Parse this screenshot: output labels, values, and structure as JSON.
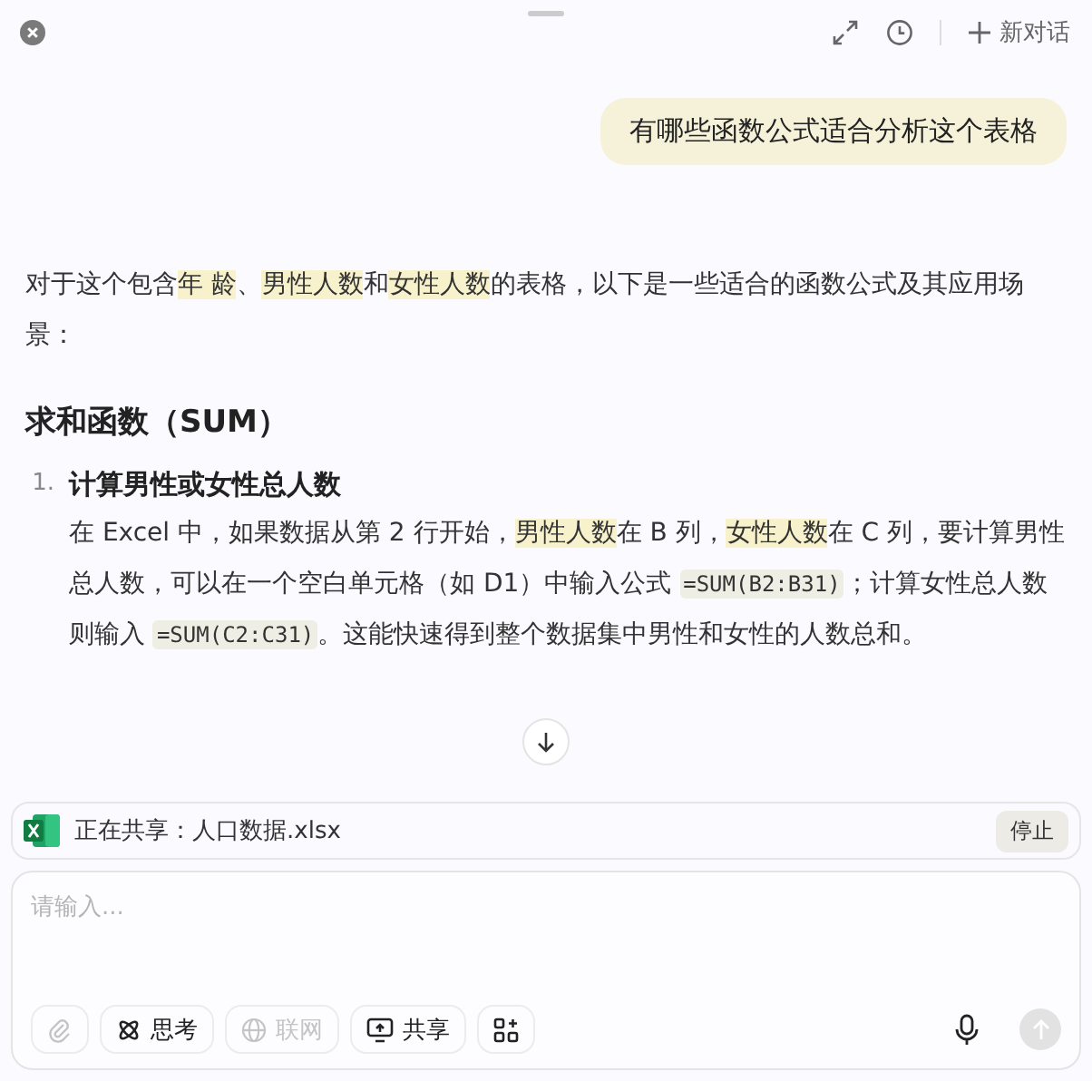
{
  "header": {
    "new_chat_label": "新对话"
  },
  "user_message": "有哪些函数公式适合分析这个表格",
  "intro": [
    {
      "kind": "plain",
      "text": "对于这个包含"
    },
    {
      "kind": "highlight",
      "text": "年  龄"
    },
    {
      "kind": "plain",
      "text": "、"
    },
    {
      "kind": "highlight",
      "text": "男性人数"
    },
    {
      "kind": "plain",
      "text": "和"
    },
    {
      "kind": "highlight",
      "text": "女性人数"
    },
    {
      "kind": "plain",
      "text": "的表格，以下是一些适合的函数公式及其应用场景："
    }
  ],
  "section_heading": "求和函数（SUM）",
  "list_items": [
    {
      "number": "1.",
      "title": "计算男性或女性总人数",
      "body": [
        {
          "kind": "plain",
          "text": "在 Excel 中，如果数据从第 2 行开始，"
        },
        {
          "kind": "highlight",
          "text": "男性人数"
        },
        {
          "kind": "plain",
          "text": "在 B 列，"
        },
        {
          "kind": "highlight",
          "text": "女性人数"
        },
        {
          "kind": "plain",
          "text": "在 C 列，要计算男性总人数，可以在一个空白单元格（如 D1）中输入公式 "
        },
        {
          "kind": "code",
          "text": "=SUM(B2:B31)"
        },
        {
          "kind": "plain",
          "text": "；计算女性总人数则输入 "
        },
        {
          "kind": "code",
          "text": "=SUM(C2:C31)"
        },
        {
          "kind": "plain",
          "text": "。这能快速得到整个数据集中男性和女性的人数总和。"
        }
      ]
    }
  ],
  "share_bar": {
    "label": "正在共享：人口数据.xlsx",
    "stop_button": "停止"
  },
  "input": {
    "placeholder": "请输入..."
  },
  "toolbar": [
    {
      "kind": "attach",
      "disabled": true
    },
    {
      "kind": "think",
      "label": "思考",
      "disabled": false
    },
    {
      "kind": "web",
      "label": "联网",
      "disabled": true
    },
    {
      "kind": "share",
      "label": "共享",
      "disabled": false
    },
    {
      "kind": "apps",
      "disabled": false
    }
  ],
  "send_button": {
    "disabled": true
  }
}
